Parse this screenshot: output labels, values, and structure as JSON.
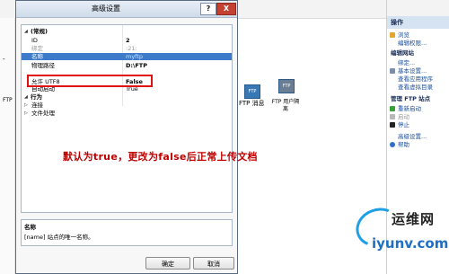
{
  "dialog": {
    "title": "高级设置",
    "help_label": "?",
    "close_label": "X",
    "ok_label": "确定",
    "cancel_label": "取消"
  },
  "properties": [
    {
      "key": "(常规)",
      "value": "",
      "type": "category",
      "expander": "◢"
    },
    {
      "key": "ID",
      "value": "2",
      "type": "item"
    },
    {
      "key": "绑定",
      "value": ":21:",
      "type": "dim"
    },
    {
      "key": "名称",
      "value": "myftp",
      "type": "selected"
    },
    {
      "key": "物理路径",
      "value": "D:\\FTP",
      "type": "item"
    },
    {
      "key": "允许 UTF8",
      "value": "False",
      "type": "item"
    },
    {
      "key": "自动启动",
      "value": "True",
      "type": "item"
    },
    {
      "key": "行为",
      "value": "",
      "type": "category",
      "expander": "◢"
    },
    {
      "key": "连接",
      "value": "",
      "type": "collapsed",
      "expander": "▷"
    },
    {
      "key": "文件处理",
      "value": "",
      "type": "collapsed",
      "expander": "▷"
    }
  ],
  "description": {
    "title": "名称",
    "text": "[name] 站点的唯一名称。"
  },
  "annotation": "默认为true，更改为false后正常上传文档",
  "background": {
    "ftp_items": [
      {
        "label": "FTP 消息",
        "icon": "ftp-messages-icon"
      },
      {
        "label": "FTP 用户隔离",
        "icon": "ftp-user-isolation-icon"
      }
    ],
    "ftp_left_label": "FTP",
    "minus_glyph": "-"
  },
  "actions": {
    "header": "操作",
    "group1": [
      {
        "label": "浏览",
        "icon": "browse-icon"
      },
      {
        "label": "编辑权限...",
        "icon": ""
      }
    ],
    "edit_site_header": "编辑网站",
    "group2": [
      {
        "label": "绑定...",
        "icon": ""
      },
      {
        "label": "基本设置...",
        "icon": "basic-settings-icon"
      },
      {
        "label": "查看应用程序",
        "icon": ""
      },
      {
        "label": "查看虚拟目录",
        "icon": ""
      }
    ],
    "manage_header": "管理 FTP 站点",
    "group3": [
      {
        "label": "重新启动",
        "icon": "restart-icon",
        "enabled": true
      },
      {
        "label": "启动",
        "icon": "start-icon",
        "enabled": false
      },
      {
        "label": "停止",
        "icon": "stop-icon",
        "enabled": true
      }
    ],
    "advanced_label": "高级设置...",
    "help_label": "帮助"
  },
  "watermark": {
    "cn": "运维网",
    "en": "iyunv.com"
  },
  "colors": {
    "selection": "#3d7ac9",
    "highlight_box": "#e01010",
    "annotation": "#c00000",
    "close_button": "#c44132"
  }
}
